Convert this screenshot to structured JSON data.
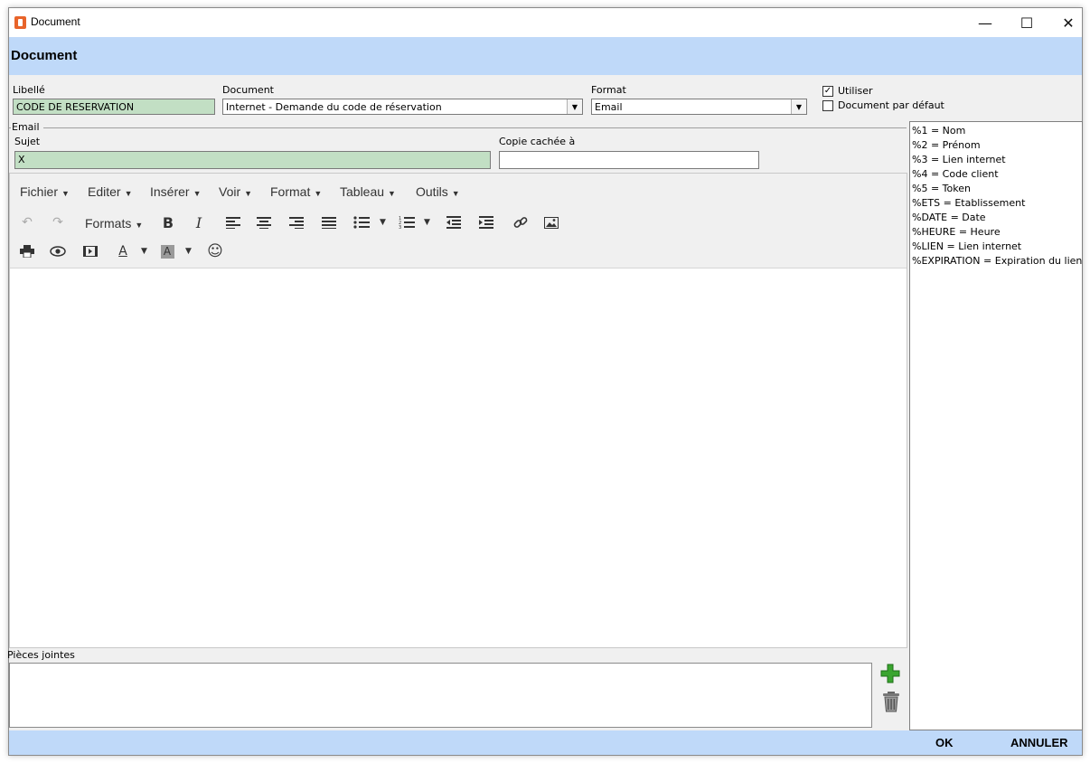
{
  "window": {
    "title": "Document",
    "controls": {
      "minimize": "—",
      "maximize": "☐",
      "close": "✕"
    }
  },
  "header": {
    "title": "Document"
  },
  "form": {
    "libelle": {
      "label": "Libellé",
      "value": "CODE DE RESERVATION"
    },
    "document": {
      "label": "Document",
      "value": "Internet - Demande du code de réservation"
    },
    "format": {
      "label": "Format",
      "value": "Email"
    },
    "utiliser": {
      "label": "Utiliser",
      "checked": true
    },
    "document_par_defaut": {
      "label": "Document par défaut",
      "checked": false
    }
  },
  "email": {
    "group_label": "Email",
    "sujet": {
      "label": "Sujet",
      "value": "X"
    },
    "copie_cachee": {
      "label": "Copie cachée à",
      "value": ""
    }
  },
  "editor": {
    "menu": [
      {
        "label": "Fichier"
      },
      {
        "label": "Editer"
      },
      {
        "label": "Insérer"
      },
      {
        "label": "Voir"
      },
      {
        "label": "Format"
      },
      {
        "label": "Tableau"
      },
      {
        "label": "Outils"
      }
    ],
    "formats_label": "Formats"
  },
  "variables": [
    "%1 = Nom",
    "%2 = Prénom",
    "%3 = Lien internet",
    "%4 = Code client",
    "%5 = Token",
    "%ETS = Etablissement",
    "%DATE = Date",
    "%HEURE = Heure",
    "%LIEN = Lien internet",
    "%EXPIRATION = Expiration du lien"
  ],
  "attachments": {
    "label": "Pièces jointes"
  },
  "footer": {
    "ok": "OK",
    "cancel": "ANNULER"
  },
  "colors": {
    "header_bg": "#bfd9f9",
    "field_green": "#c2dfc4",
    "add_icon": "#3aa52f"
  }
}
